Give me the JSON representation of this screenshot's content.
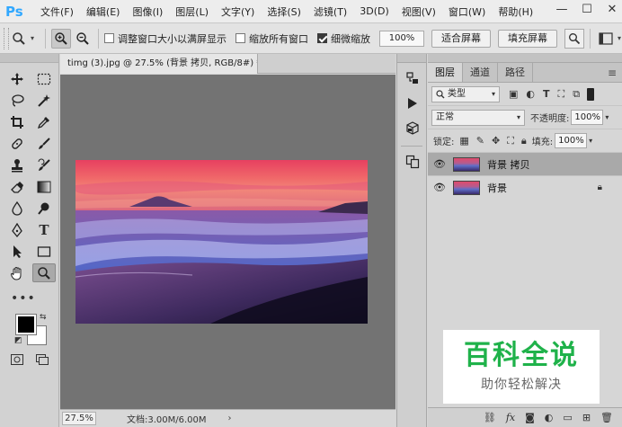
{
  "app": {
    "logo": "Ps",
    "menu": [
      "文件(F)",
      "编辑(E)",
      "图像(I)",
      "图层(L)",
      "文字(Y)",
      "选择(S)",
      "滤镜(T)",
      "3D(D)",
      "视图(V)",
      "窗口(W)",
      "帮助(H)"
    ],
    "window_controls": {
      "minimize": "—",
      "maximize": "☐",
      "close": "✕"
    }
  },
  "options": {
    "resize_windows_label": "调整窗口大小以满屏显示",
    "resize_windows_checked": false,
    "zoom_all_label": "缩放所有窗口",
    "zoom_all_checked": false,
    "scrubby_zoom_label": "细微缩放",
    "scrubby_zoom_checked": true,
    "zoom_value": "100%",
    "fit_screen_label": "适合屏幕",
    "fill_screen_label": "填充屏幕"
  },
  "document": {
    "tab_title": "timg (3).jpg @ 27.5% (背景 拷贝, RGB/8#) *",
    "tab_close": "×",
    "zoom_level": "27.5%",
    "doc_size": "文档:3.00M/6.00M",
    "status_arrow": "›"
  },
  "layers_panel": {
    "tabs": [
      "图层",
      "通道",
      "路径"
    ],
    "active_tab": 0,
    "filter_kind": "类型",
    "blend_mode": "正常",
    "opacity_label": "不透明度:",
    "opacity_value": "100%",
    "lock_label": "锁定:",
    "fill_label": "填充:",
    "fill_value": "100%",
    "layers": [
      {
        "name": "背景 拷贝",
        "visible": true,
        "locked": false,
        "selected": true
      },
      {
        "name": "背景",
        "visible": true,
        "locked": true,
        "selected": false
      }
    ]
  },
  "watermark": {
    "title": "百科全说",
    "subtitle": "助你轻松解决"
  },
  "colors": {
    "foreground": "#000000",
    "background": "#ffffff",
    "ps_blue": "#31a8ff",
    "watermark_green": "#1fb24a"
  }
}
